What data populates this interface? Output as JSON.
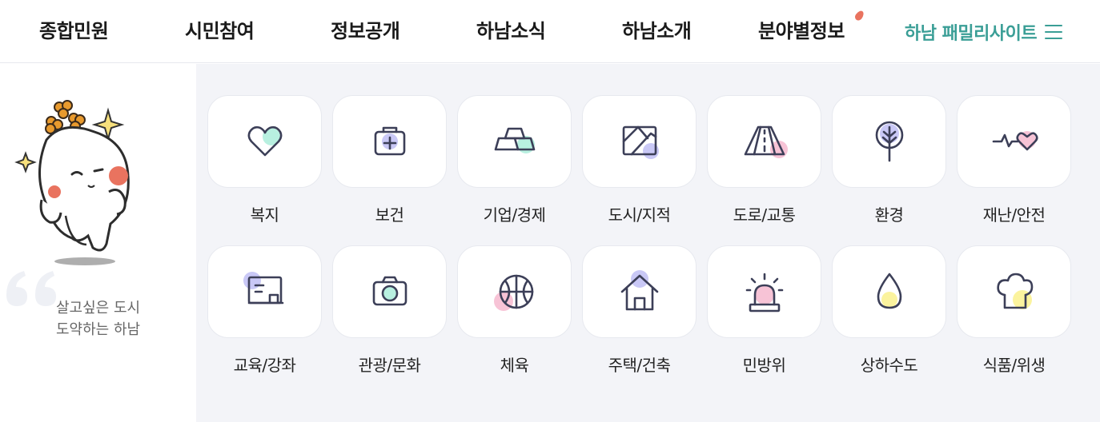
{
  "nav": {
    "items": [
      "종합민원",
      "시민참여",
      "정보공개",
      "하남소식",
      "하남소개",
      "분야별정보"
    ],
    "family_label": "하남 패밀리사이트"
  },
  "slogan": {
    "line1": "살고싶은 도시",
    "line2": "도약하는 하남"
  },
  "categories": [
    {
      "label": "복지",
      "icon": "heart-icon"
    },
    {
      "label": "보건",
      "icon": "first-aid-kit-icon"
    },
    {
      "label": "기업/경제",
      "icon": "gold-bars-icon"
    },
    {
      "label": "도시/지적",
      "icon": "city-map-icon"
    },
    {
      "label": "도로/교통",
      "icon": "road-icon"
    },
    {
      "label": "환경",
      "icon": "tree-icon"
    },
    {
      "label": "재난/안전",
      "icon": "heartbeat-icon"
    },
    {
      "label": "교육/강좌",
      "icon": "blackboard-icon"
    },
    {
      "label": "관광/문화",
      "icon": "camera-icon"
    },
    {
      "label": "체육",
      "icon": "basketball-icon"
    },
    {
      "label": "주택/건축",
      "icon": "house-icon"
    },
    {
      "label": "민방위",
      "icon": "siren-icon"
    },
    {
      "label": "상하수도",
      "icon": "water-drop-icon"
    },
    {
      "label": "식품/위생",
      "icon": "chef-hat-icon"
    }
  ],
  "colors": {
    "accent": "#3a9e96",
    "nav_dot": "#e9735f",
    "icon_stroke": "#3c3f58",
    "mint": "#b8f0e0",
    "lavender": "#c9c8f6",
    "pink": "#f7c3d6",
    "yellow": "#fbf39e",
    "grid_background": "#f3f4f8"
  }
}
